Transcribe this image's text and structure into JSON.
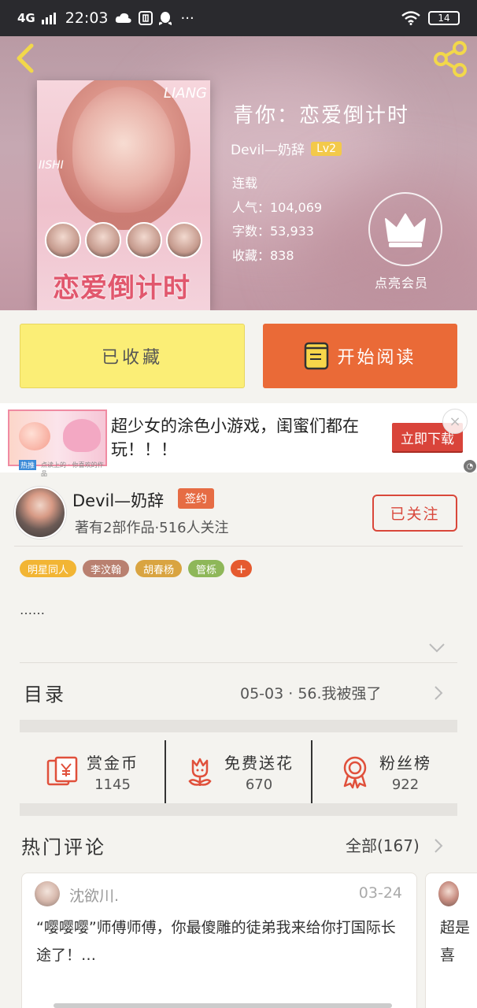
{
  "status_bar": {
    "network": "4G",
    "time": "22:03",
    "icons": [
      "signal-icon",
      "cloud-icon",
      "tiktok-icon",
      "qq-icon",
      "more-icon",
      "wifi-icon",
      "battery-icon"
    ],
    "more": "···",
    "battery": "14"
  },
  "header": {
    "cover": {
      "title_art": "恋爱倒计时",
      "tag_top": "LIANG",
      "tag_side": "IISHI"
    },
    "book_title": "青你：恋爱倒计时",
    "author": "Devil—奶辞",
    "level": "Lv2",
    "status": "连载",
    "popularity": "人气：104,069",
    "word_count": "字数：53,933",
    "favorites": "收藏：838",
    "vip_label": "点亮会员"
  },
  "actions": {
    "collected": "已收藏",
    "start_reading": "开始阅读"
  },
  "ad": {
    "text": "超少女的涂色小游戏，闺蜜们都在玩！！！",
    "tag": "热推",
    "sub": "点读上的 · 你喜欢的作品",
    "cta": "立即下载",
    "close": "×",
    "mark": "◔"
  },
  "author_section": {
    "name": "Devil—奶辞",
    "badge": "签约",
    "stats": "著有2部作品·516人关注",
    "follow": "已关注",
    "tags": [
      {
        "label": "明星同人",
        "color": "#f2b534"
      },
      {
        "label": "李汶翰",
        "color": "#b98070"
      },
      {
        "label": "胡春杨",
        "color": "#d9a441"
      },
      {
        "label": "管栎",
        "color": "#8eb759"
      }
    ],
    "tag_more": "+",
    "description": "……"
  },
  "toc": {
    "label": "目录",
    "latest": "05-03 · 56.我被强了"
  },
  "stats": [
    {
      "title": "赏金币",
      "value": "1145",
      "icon": "coin-envelope-icon"
    },
    {
      "title": "免费送花",
      "value": "670",
      "icon": "flower-icon"
    },
    {
      "title": "粉丝榜",
      "value": "922",
      "icon": "medal-icon"
    }
  ],
  "hot_comments": {
    "label": "热门评论",
    "all": "全部(167)",
    "cards": [
      {
        "name": "沈欲川.",
        "date": "03-24",
        "body": "“嘤嘤嘤”师傅师傅，你最傻雕的徒弟我来给你打国际长途了！…"
      },
      {
        "body": "超是喜"
      }
    ]
  },
  "colors": {
    "accent_orange": "#ea6a37",
    "collected_yellow": "#fbee76",
    "follow_red": "#d9473a",
    "sign_badge": "#e66c44"
  }
}
